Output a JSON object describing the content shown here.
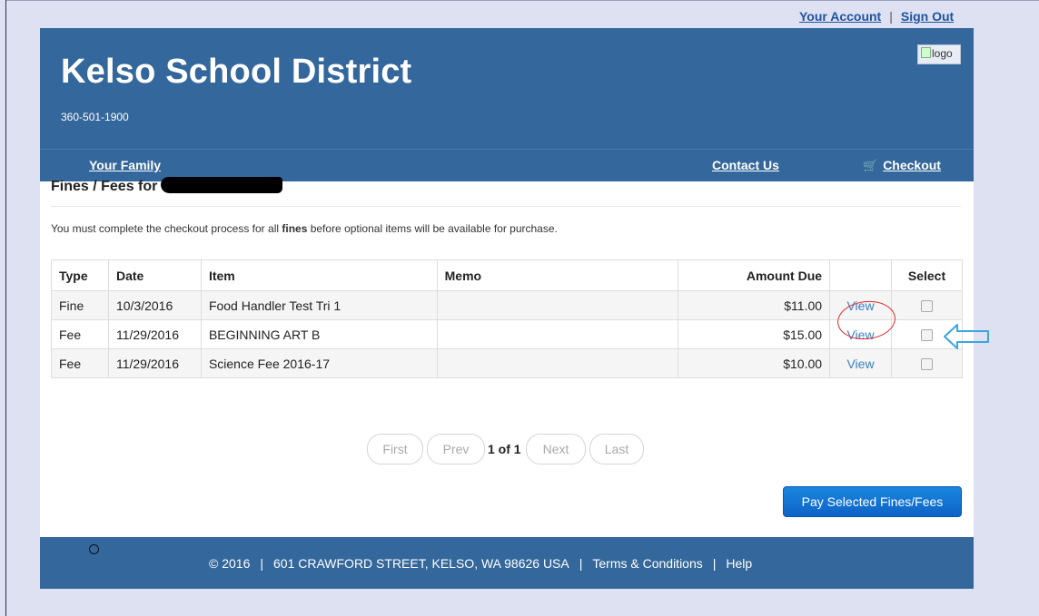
{
  "top_links": {
    "account": "Your Account",
    "separator": "|",
    "sign_out": "Sign Out"
  },
  "header": {
    "title": "Kelso School District",
    "phone": "360-501-1900",
    "logo_alt": "logo"
  },
  "nav": {
    "family": "Your Family",
    "contact": "Contact Us",
    "checkout": "Checkout"
  },
  "page": {
    "title_prefix": "Fines / Fees for",
    "notice_before": "You must complete the checkout process for all ",
    "notice_bold": "fines",
    "notice_after": " before optional items will be available for purchase."
  },
  "table": {
    "headers": {
      "type": "Type",
      "date": "Date",
      "item": "Item",
      "memo": "Memo",
      "amount": "Amount Due",
      "select": "Select"
    },
    "rows": [
      {
        "type": "Fine",
        "date": "10/3/2016",
        "item": "Food Handler Test Tri 1",
        "memo": "",
        "amount": "$11.00",
        "view": "View"
      },
      {
        "type": "Fee",
        "date": "11/29/2016",
        "item": "BEGINNING ART B",
        "memo": "",
        "amount": "$15.00",
        "view": "View"
      },
      {
        "type": "Fee",
        "date": "11/29/2016",
        "item": "Science Fee 2016-17",
        "memo": "",
        "amount": "$10.00",
        "view": "View"
      }
    ]
  },
  "pager": {
    "first": "First",
    "prev": "Prev",
    "info": "1 of 1",
    "next": "Next",
    "last": "Last"
  },
  "pay_button": "Pay Selected Fines/Fees",
  "footer": {
    "copyright": "© 2016",
    "address": "601 CRAWFORD STREET, KELSO, WA 98626 USA",
    "terms": "Terms & Conditions",
    "help": "Help",
    "separator": "|"
  },
  "colors": {
    "brand": "#34679b",
    "link": "#3a7fc3",
    "annotation_circle": "#e0282c",
    "annotation_arrow": "#3aa6e0",
    "button": "#0d63c7"
  }
}
